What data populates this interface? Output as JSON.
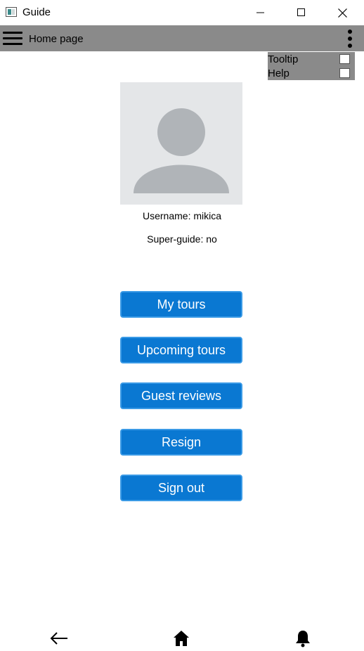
{
  "window": {
    "title": "Guide"
  },
  "appbar": {
    "title": "Home page"
  },
  "options": [
    {
      "label": "Tooltip",
      "checked": false
    },
    {
      "label": "Help",
      "checked": false
    }
  ],
  "profile": {
    "username_text": "Username: mikica",
    "superguide_text": "Super-guide: no"
  },
  "actions": [
    {
      "label": "My tours"
    },
    {
      "label": "Upcoming tours"
    },
    {
      "label": "Guest reviews"
    },
    {
      "label": "Resign"
    },
    {
      "label": "Sign out"
    }
  ],
  "colors": {
    "appbar": "#8a8a8a",
    "button": "#0a78d2",
    "avatar_bg": "#e4e6e8",
    "avatar_fg": "#b0b4b8"
  },
  "icons": {
    "app": "app-window-icon",
    "back": "arrow-left-icon",
    "home": "home-icon",
    "notifications": "bell-icon"
  }
}
